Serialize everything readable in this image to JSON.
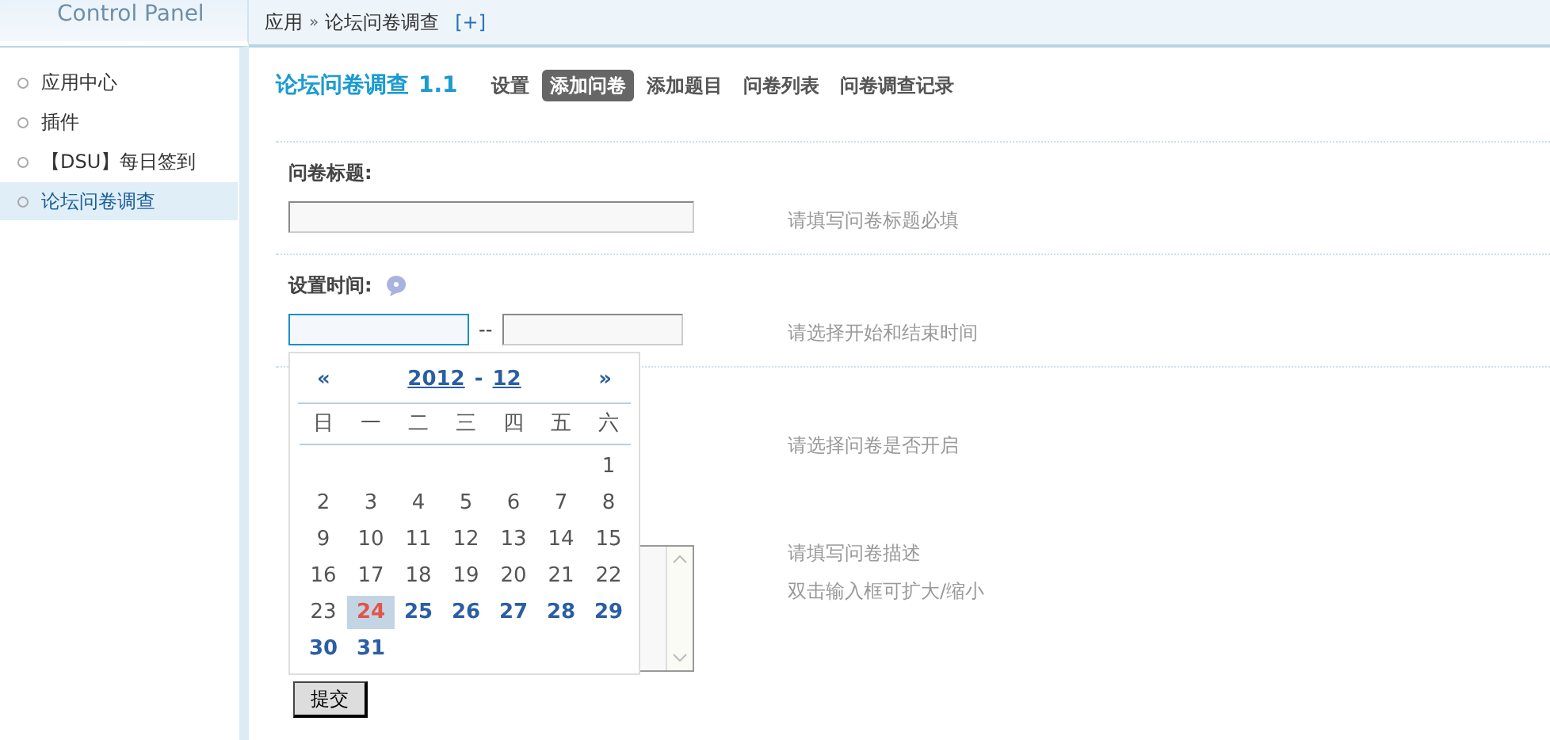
{
  "header": {
    "logo_text": "Control Panel",
    "breadcrumb": [
      "应用",
      "论坛问卷调查"
    ],
    "breadcrumb_separator": "»",
    "add_link": "[+]"
  },
  "sidebar": {
    "items": [
      {
        "label": "应用中心",
        "selected": false
      },
      {
        "label": "插件",
        "selected": false
      },
      {
        "label": "【DSU】每日签到",
        "selected": false
      },
      {
        "label": "论坛问卷调查",
        "selected": true
      }
    ]
  },
  "plugin": {
    "title": "论坛问卷调查",
    "version": "1.1",
    "tabs": [
      {
        "label": "设置",
        "selected": false
      },
      {
        "label": "添加问卷",
        "selected": true
      },
      {
        "label": "添加题目",
        "selected": false
      },
      {
        "label": "问卷列表",
        "selected": false
      },
      {
        "label": "问卷调查记录",
        "selected": false
      }
    ]
  },
  "form": {
    "rows": [
      {
        "kind": "text",
        "label": "问卷标题:",
        "hints": [
          "请填写问卷标题必填"
        ]
      },
      {
        "kind": "daterange",
        "label": "设置时间:",
        "separator": "--",
        "hints": [
          "请选择开始和结束时间"
        ]
      },
      {
        "kind": "covered",
        "hints": [
          "请选择问卷是否开启"
        ]
      },
      {
        "kind": "textarea",
        "hints": [
          "请填写问卷描述",
          "双击输入框可扩大/缩小"
        ]
      }
    ],
    "submit": "提交"
  },
  "calendar": {
    "prev": "«",
    "year": "2012",
    "dash": "-",
    "month": "12",
    "next": "»",
    "weekdays": [
      "日",
      "一",
      "二",
      "三",
      "四",
      "五",
      "六"
    ],
    "days": [
      {
        "text": "1",
        "kind": "past"
      },
      {
        "text": "2",
        "kind": "past"
      },
      {
        "text": "3",
        "kind": "past"
      },
      {
        "text": "4",
        "kind": "past"
      },
      {
        "text": "5",
        "kind": "past"
      },
      {
        "text": "6",
        "kind": "past"
      },
      {
        "text": "7",
        "kind": "past"
      },
      {
        "text": "8",
        "kind": "past"
      },
      {
        "text": "9",
        "kind": "past"
      },
      {
        "text": "10",
        "kind": "past"
      },
      {
        "text": "11",
        "kind": "past"
      },
      {
        "text": "12",
        "kind": "past"
      },
      {
        "text": "13",
        "kind": "past"
      },
      {
        "text": "14",
        "kind": "past"
      },
      {
        "text": "15",
        "kind": "past"
      },
      {
        "text": "16",
        "kind": "past"
      },
      {
        "text": "17",
        "kind": "past"
      },
      {
        "text": "18",
        "kind": "past"
      },
      {
        "text": "19",
        "kind": "past"
      },
      {
        "text": "20",
        "kind": "past"
      },
      {
        "text": "21",
        "kind": "past"
      },
      {
        "text": "22",
        "kind": "past"
      },
      {
        "text": "23",
        "kind": "past"
      },
      {
        "text": "24",
        "kind": "today"
      },
      {
        "text": "25",
        "kind": "future"
      },
      {
        "text": "26",
        "kind": "future"
      },
      {
        "text": "27",
        "kind": "future"
      },
      {
        "text": "28",
        "kind": "future"
      },
      {
        "text": "29",
        "kind": "future"
      },
      {
        "text": "30",
        "kind": "future"
      },
      {
        "text": "31",
        "kind": "future"
      }
    ]
  }
}
